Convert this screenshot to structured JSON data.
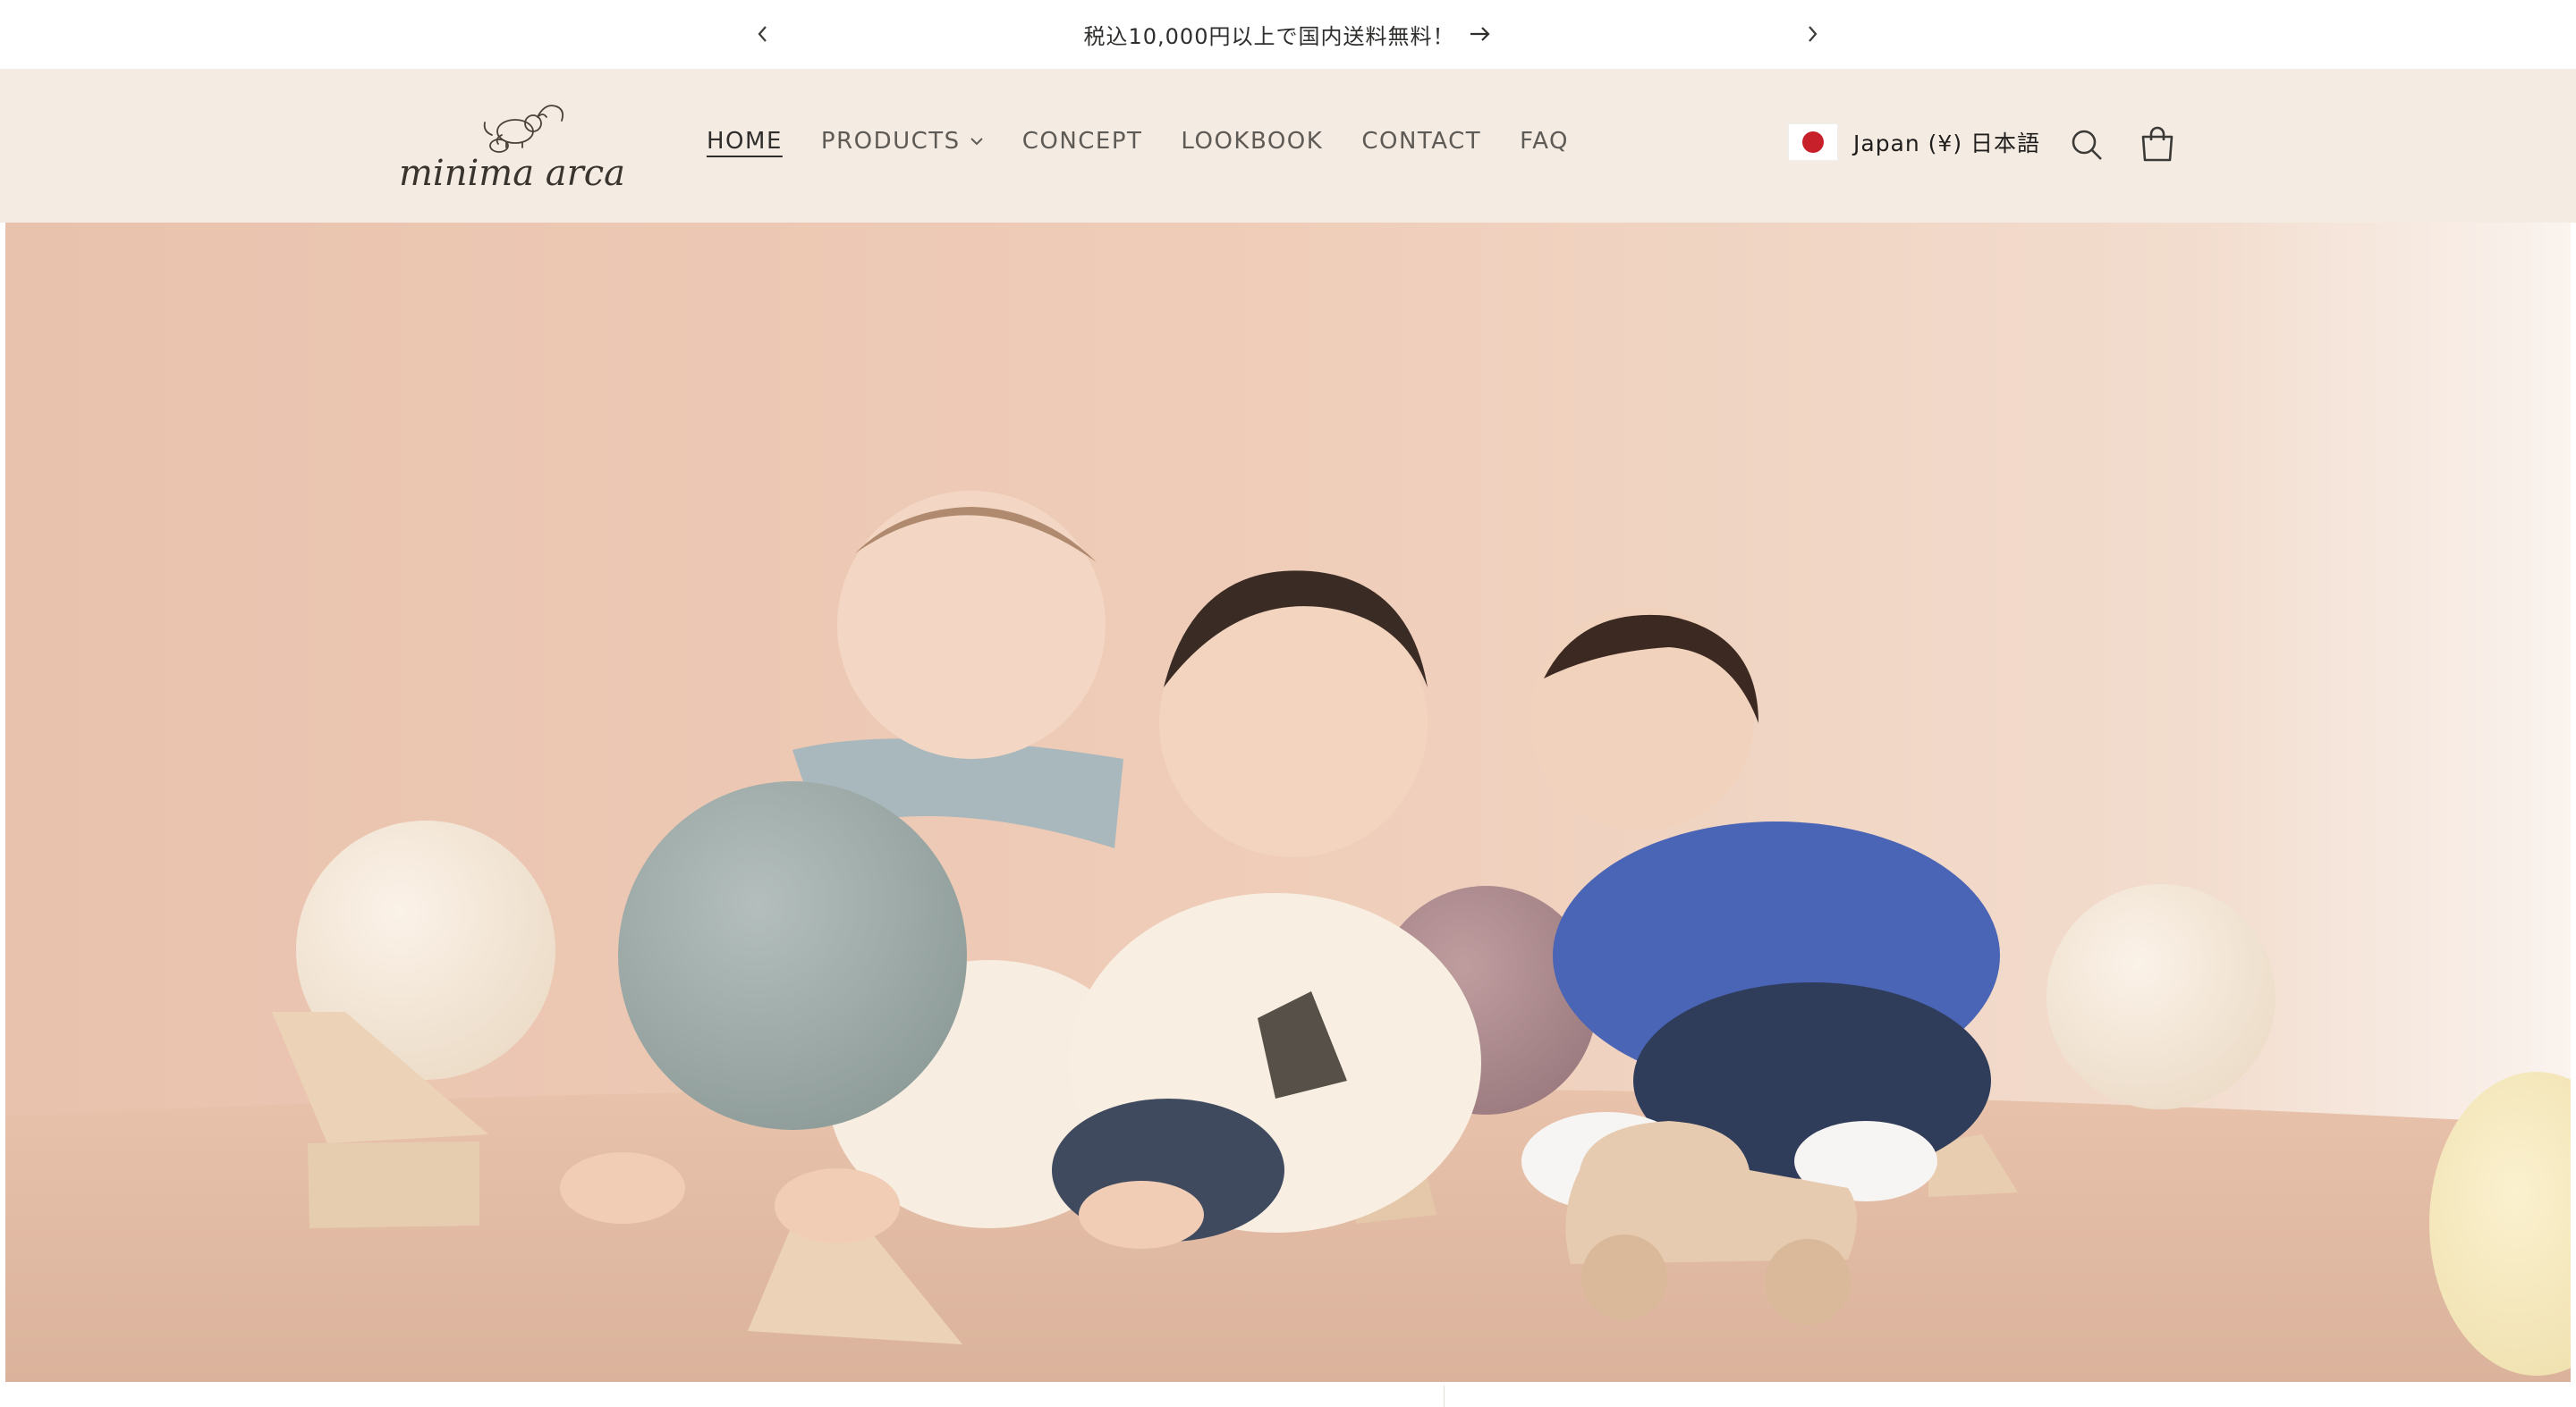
{
  "announcement": {
    "text": "税込10,000円以上で国内送料無料！",
    "prev_icon": "chevron-left-icon",
    "next_icon": "chevron-right-icon",
    "link_icon": "arrow-right-icon"
  },
  "header": {
    "logo_text": "minima arca",
    "nav": [
      {
        "label": "HOME",
        "active": true
      },
      {
        "label": "PRODUCTS",
        "has_dropdown": true
      },
      {
        "label": "CONCEPT"
      },
      {
        "label": "LOOKBOOK"
      },
      {
        "label": "CONTACT"
      },
      {
        "label": "FAQ"
      }
    ],
    "locale": "Japan (¥) 日本語",
    "search_icon": "search-icon",
    "cart_icon": "cart-icon"
  },
  "colors": {
    "header_bg": "#f4ebe3",
    "hero_bg": "#ecc9b5",
    "flag_red": "#c8202a"
  },
  "hero": {
    "image": "hero-photo"
  }
}
